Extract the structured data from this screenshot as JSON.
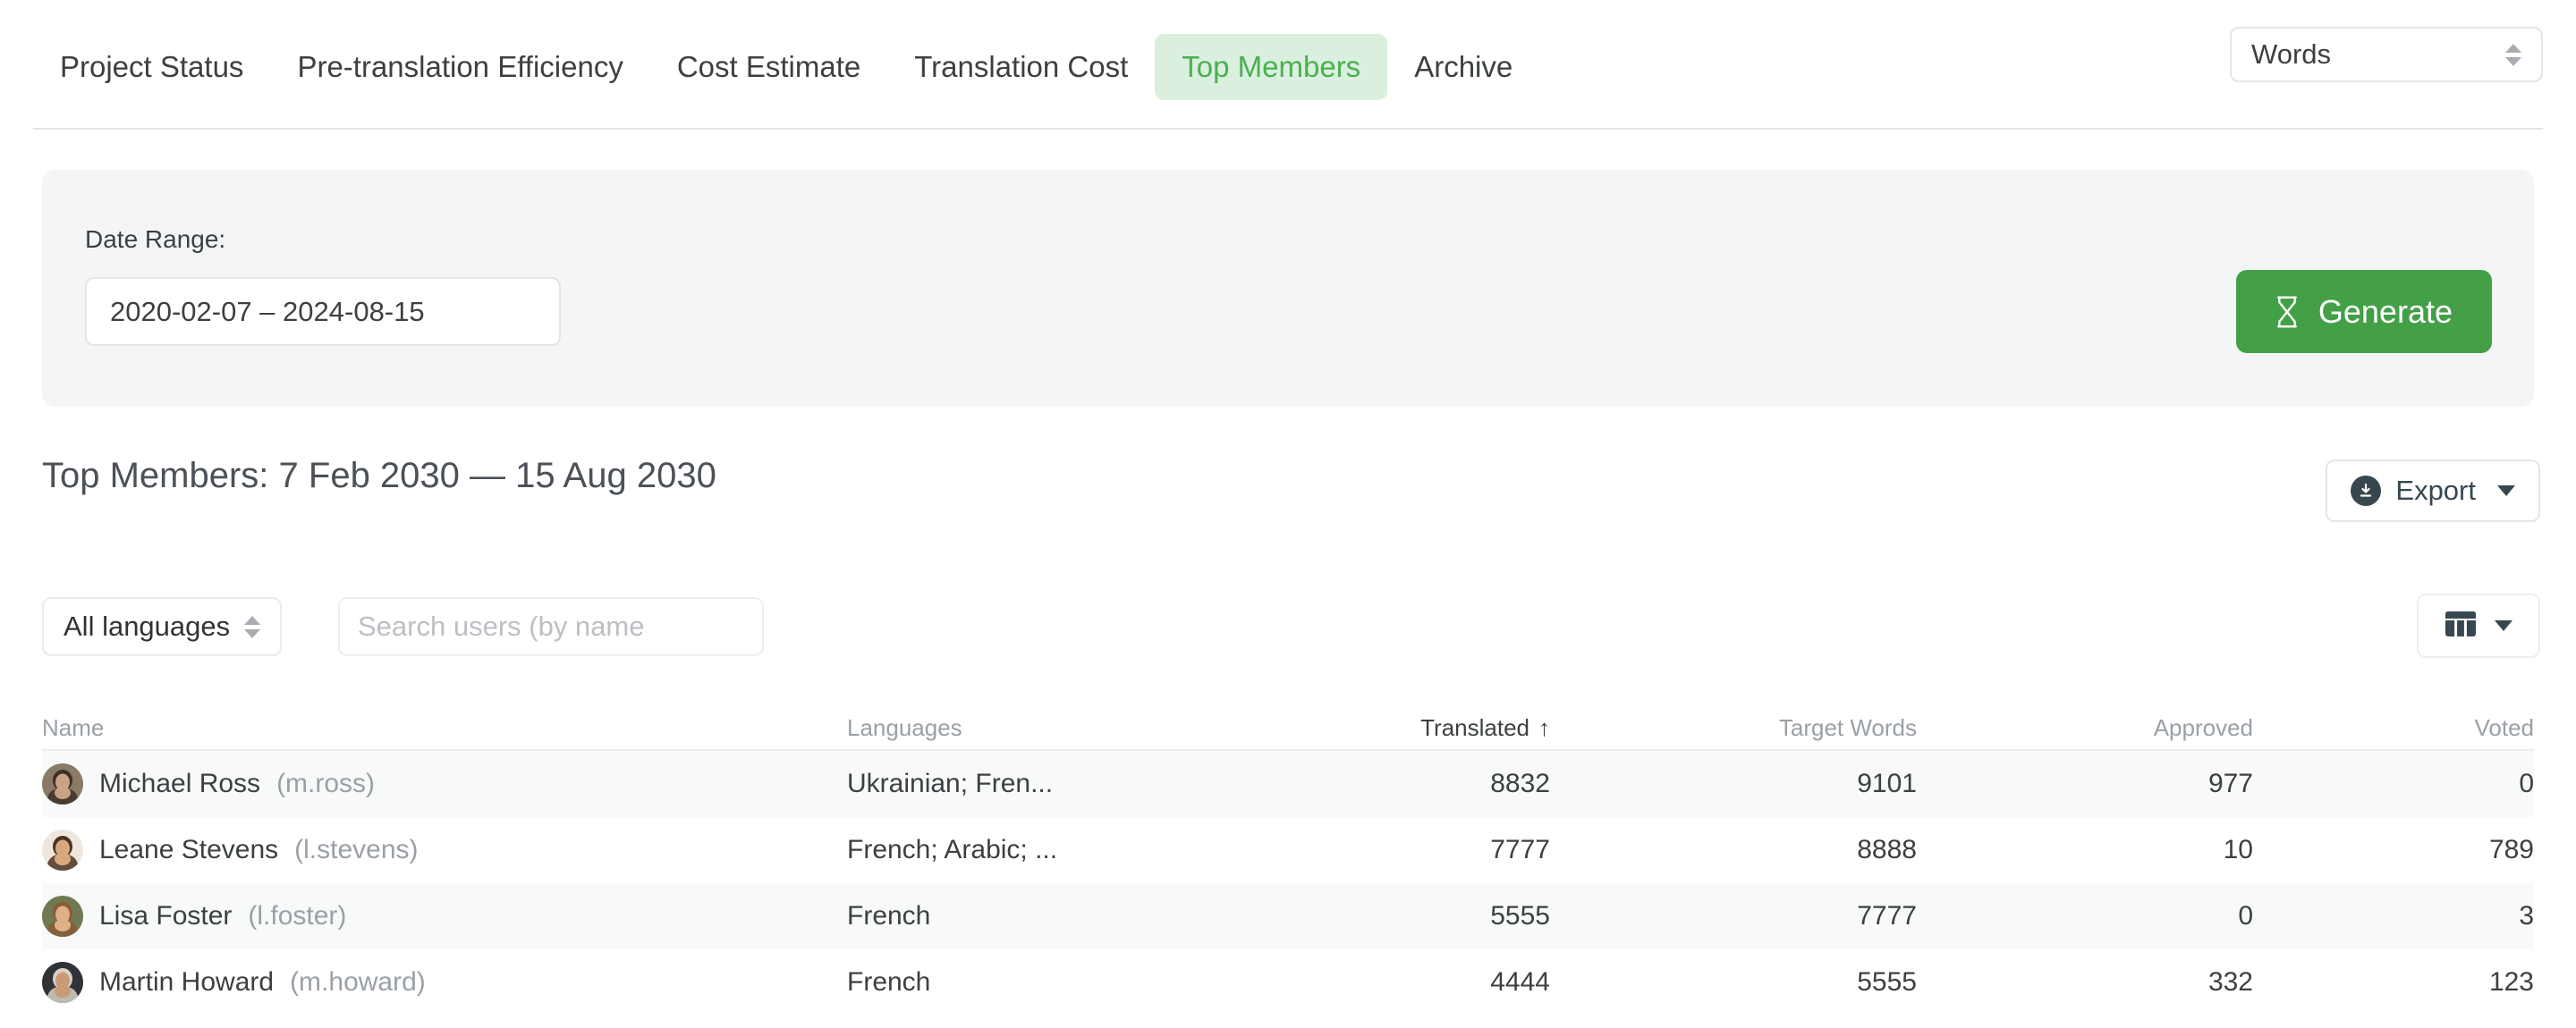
{
  "tabs": [
    {
      "label": "Project Status",
      "active": false
    },
    {
      "label": "Pre-translation Efficiency",
      "active": false
    },
    {
      "label": "Cost Estimate",
      "active": false
    },
    {
      "label": "Translation Cost",
      "active": false
    },
    {
      "label": "Top Members",
      "active": true
    },
    {
      "label": "Archive",
      "active": false
    }
  ],
  "unit_select": {
    "value": "Words"
  },
  "date_panel": {
    "label": "Date Range:",
    "value": "2020-02-07 – 2024-08-15",
    "generate_label": "Generate"
  },
  "title": "Top Members: 7 Feb 2030 — 15 Aug 2030",
  "export": {
    "label": "Export"
  },
  "filters": {
    "language_select": "All languages",
    "search_placeholder": "Search users (by name"
  },
  "table": {
    "columns": [
      {
        "key": "name",
        "label": "Name",
        "sorted": false
      },
      {
        "key": "lang",
        "label": "Languages",
        "sorted": false
      },
      {
        "key": "trans",
        "label": "Translated",
        "sorted": true,
        "sort_dir": "↑"
      },
      {
        "key": "target",
        "label": "Target Words",
        "sorted": false
      },
      {
        "key": "appr",
        "label": "Approved",
        "sorted": false
      },
      {
        "key": "voted",
        "label": "Voted",
        "sorted": false
      }
    ],
    "rows": [
      {
        "name": "Michael Ross",
        "username": "(m.ross)",
        "languages": "Ukrainian; Fren...",
        "translated": "8832",
        "target_words": "9101",
        "approved": "977",
        "voted": "0",
        "avatar": {
          "name": "avatar-michael-ross",
          "bg": "#8a7a66",
          "skin": "#c9a383",
          "hair": "#3e3028"
        }
      },
      {
        "name": "Leane Stevens",
        "username": "(l.stevens)",
        "languages": "French; Arabic; ...",
        "translated": "7777",
        "target_words": "8888",
        "approved": "10",
        "voted": "789",
        "avatar": {
          "name": "avatar-leane-stevens",
          "bg": "#efe7dd",
          "skin": "#d9a87f",
          "hair": "#4a3324"
        }
      },
      {
        "name": "Lisa Foster",
        "username": "(l.foster)",
        "languages": "French",
        "translated": "5555",
        "target_words": "7777",
        "approved": "0",
        "voted": "3",
        "avatar": {
          "name": "avatar-lisa-foster",
          "bg": "#6f7a52",
          "skin": "#e0b089",
          "hair": "#8a5b36"
        }
      },
      {
        "name": "Martin Howard",
        "username": "(m.howard)",
        "languages": "French",
        "translated": "4444",
        "target_words": "5555",
        "approved": "332",
        "voted": "123",
        "avatar": {
          "name": "avatar-martin-howard",
          "bg": "#2f3338",
          "skin": "#c99a76",
          "hair": "#d8d2c6"
        }
      }
    ]
  },
  "colors": {
    "accent_green": "#43a047",
    "tab_active_bg": "#d9f0de",
    "tab_active_text": "#4caf50",
    "text_primary": "#3c4043",
    "text_muted": "#9aa0a6",
    "panel_bg": "#f4f5f6",
    "row_alt_bg": "#f8f9f9"
  }
}
